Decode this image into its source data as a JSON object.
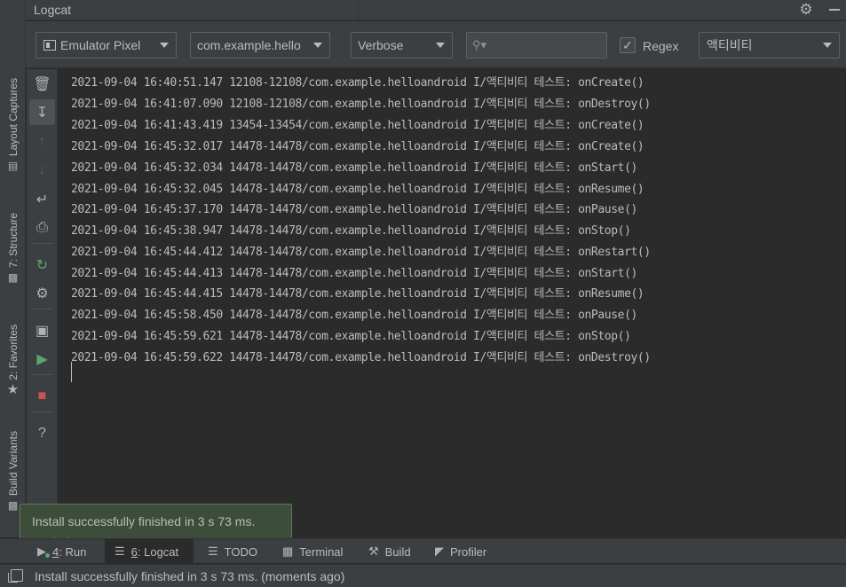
{
  "header": {
    "title": "Logcat"
  },
  "left_stripe": {
    "layout_captures": "Layout Captures",
    "structure": "7: Structure",
    "favorites": "2: Favorites",
    "build_variants": "Build Variants"
  },
  "toolbar": {
    "device": "Emulator Pixel",
    "process": "com.example.hello",
    "level": "Verbose",
    "search_placeholder": "",
    "regex_checked": true,
    "regex_label": "Regex",
    "filter": "액티비티"
  },
  "log_lines": [
    "2021-09-04 16:40:51.147 12108-12108/com.example.helloandroid I/액티비티 테스트: onCreate()",
    "2021-09-04 16:41:07.090 12108-12108/com.example.helloandroid I/액티비티 테스트: onDestroy()",
    "2021-09-04 16:41:43.419 13454-13454/com.example.helloandroid I/액티비티 테스트: onCreate()",
    "2021-09-04 16:45:32.017 14478-14478/com.example.helloandroid I/액티비티 테스트: onCreate()",
    "2021-09-04 16:45:32.034 14478-14478/com.example.helloandroid I/액티비티 테스트: onStart()",
    "2021-09-04 16:45:32.045 14478-14478/com.example.helloandroid I/액티비티 테스트: onResume()",
    "2021-09-04 16:45:37.170 14478-14478/com.example.helloandroid I/액티비티 테스트: onPause()",
    "2021-09-04 16:45:38.947 14478-14478/com.example.helloandroid I/액티비티 테스트: onStop()",
    "2021-09-04 16:45:44.412 14478-14478/com.example.helloandroid I/액티비티 테스트: onRestart()",
    "2021-09-04 16:45:44.413 14478-14478/com.example.helloandroid I/액티비티 테스트: onStart()",
    "2021-09-04 16:45:44.415 14478-14478/com.example.helloandroid I/액티비티 테스트: onResume()",
    "2021-09-04 16:45:58.450 14478-14478/com.example.helloandroid I/액티비티 테스트: onPause()",
    "2021-09-04 16:45:59.621 14478-14478/com.example.helloandroid I/액티비티 테스트: onStop()",
    "2021-09-04 16:45:59.622 14478-14478/com.example.helloandroid I/액티비티 테스트: onDestroy()"
  ],
  "balloon": {
    "text": "Install successfully finished in 3 s 73 ms."
  },
  "bottom_tabs": {
    "run_num": "4",
    "run_label": ": Run",
    "logcat_num": "6",
    "logcat_label": ": Logcat",
    "todo": "TODO",
    "terminal": "Terminal",
    "build": "Build",
    "profiler": "Profiler"
  },
  "status": {
    "text": "Install successfully finished in 3 s 73 ms. (moments ago)"
  },
  "icons": {
    "header": [
      "gear-icon",
      "minimize-icon"
    ],
    "vertical_toolbar": [
      "trash-icon",
      "scroll-to-end-icon",
      "up-arrow-icon",
      "down-arrow-icon",
      "soft-wrap-icon",
      "print-icon",
      "restart-icon",
      "settings-icon",
      "camera-icon",
      "screen-record-icon",
      "stop-icon",
      "help-icon"
    ]
  },
  "colors": {
    "background": "#2b2b2b",
    "panel": "#3c3f41",
    "text": "#bbbbbb",
    "balloon_bg": "#3d4d3c",
    "run_green": "#59a869",
    "stop_red": "#c75450"
  }
}
